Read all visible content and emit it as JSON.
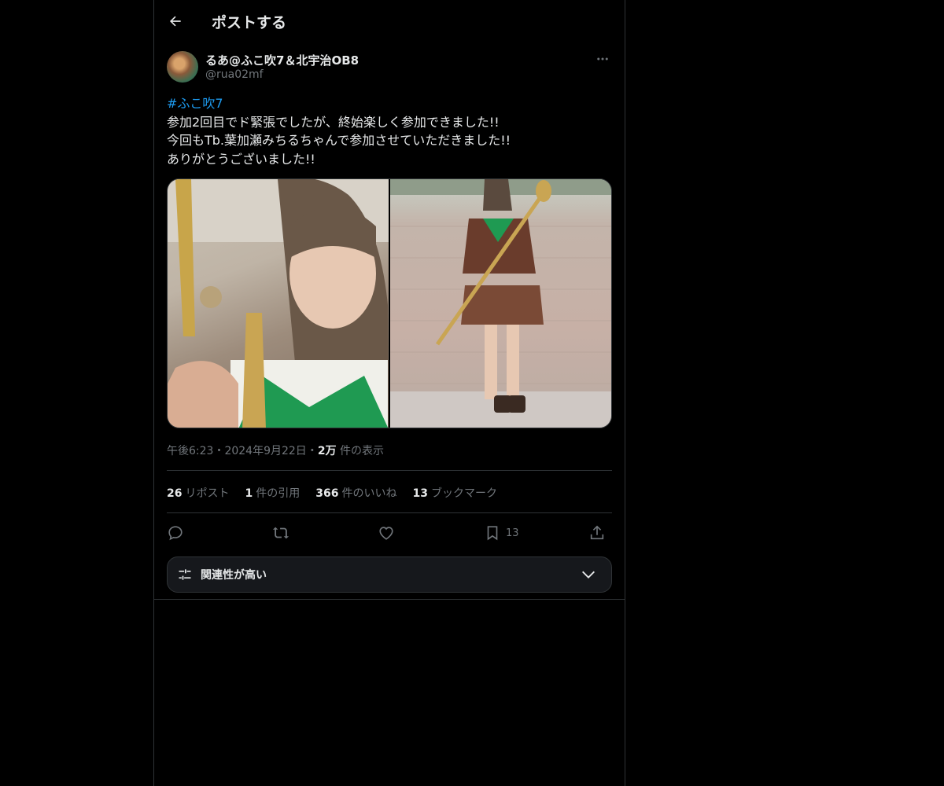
{
  "header": {
    "title": "ポストする"
  },
  "author": {
    "name": "るあ@ふこ吹7＆北宇治OB8",
    "handle": "@rua02mf"
  },
  "post": {
    "hashtag": "#ふこ吹7",
    "lines": [
      "参加2回目でド緊張でしたが、終始楽しく参加できました!!",
      "今回もTb.葉加瀬みちるちゃんで参加させていただきました!!",
      "ありがとうございました!!"
    ]
  },
  "meta": {
    "time": "午後6:23",
    "sep1": "・",
    "date": "2024年9月22日",
    "sep2": "・",
    "views_value": "2万",
    "views_label": "件の表示"
  },
  "stats": [
    {
      "value": "26",
      "label": "リポスト"
    },
    {
      "value": "1",
      "label": "件の引用"
    },
    {
      "value": "366",
      "label": "件のいいね"
    },
    {
      "value": "13",
      "label": "ブックマーク"
    }
  ],
  "actions": {
    "bookmark_count": "13"
  },
  "sort": {
    "label": "関連性が高い"
  },
  "colors": {
    "background": "#000000",
    "text": "#e7e9ea",
    "muted": "#71767b",
    "link": "#1d9bf0",
    "border": "#2f3336"
  },
  "icons": [
    "back-arrow-icon",
    "more-icon",
    "reply-icon",
    "repost-icon",
    "like-icon",
    "bookmark-icon",
    "share-icon",
    "sliders-icon",
    "chevron-down-icon"
  ]
}
